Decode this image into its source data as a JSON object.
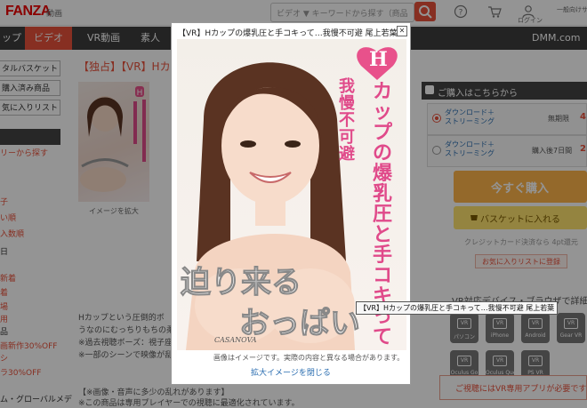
{
  "header": {
    "logo": "FANZA",
    "logo_sub": "動画",
    "search_placeholder": "ビデオ ▼  キーワードから探す（商品",
    "icons": [
      "question-icon",
      "cart-icon",
      "user-icon"
    ],
    "icon_labels": [
      "ログイン",
      "一般向けサ"
    ]
  },
  "nav": {
    "items": [
      "ップ",
      "ビデオ",
      "VR動画",
      "素人",
      "DMM.com"
    ],
    "active_index": 1
  },
  "sidebar": {
    "buttons": [
      "タルバスケット",
      "購入済み商品",
      "気に入りリスト"
    ],
    "section_label": "リーから探す",
    "red_items": [
      "子",
      "い順",
      "入数順"
    ],
    "black_items": [
      "日"
    ],
    "more_red": [
      "新着",
      "着",
      "場",
      "用"
    ],
    "more_black": [
      "品"
    ],
    "sale_items": [
      "画新作30%OFF",
      "シ",
      "ラ30%OFF"
    ],
    "bottom_items": [
      "ム・グローバルメデ"
    ]
  },
  "main": {
    "title": "【独占】【VR】Hカ",
    "thumb_caption": "イメージを拡大",
    "body_lines": [
      "Hカップという圧倒的ボ",
      "うなのにむっちりもちの柔ら",
      "※過去視聴ボーズ：視子座",
      "※一部のシーンで映像が乱れ",
      "【※画像・音声に多少の乱れがあります】",
      "※この商品は専用プレイヤーでの視聴に最適化されています。"
    ]
  },
  "right": {
    "header": "ご購入はこちらから",
    "options": [
      {
        "label1": "ダウンロード＋",
        "label2": "ストリーミング",
        "price_label": "無期限",
        "price": "4",
        "selected": true
      },
      {
        "label1": "ダウンロード＋",
        "label2": "ストリーミング",
        "price_label": "購入後7日間",
        "price": "2",
        "selected": false
      }
    ],
    "buy": "今すぐ購入",
    "basket": "バスケットに入れる",
    "credit": "クレジットカード決済なら 4pt還元",
    "favorite": "お気に入りリストに登録",
    "vr_header": "VR対応デバイス・ブラウザで詳細表示",
    "devices": [
      "パソコン",
      "iPhone",
      "Android",
      "Gear VR",
      "Oculus Go",
      "Oculus Quest",
      "PS VR"
    ],
    "vr_notice": "ご視聴にはVR専用アプリが必要です"
  },
  "modal": {
    "title": "【VR】Hカップの爆乳圧と手コキって…我慢不可避 尾上若葉",
    "close": "✕",
    "note": "画像はイメージです。実際の内容と異なる場合があります。",
    "close_link": "拡大イメージを閉じる",
    "tooltip": "【VR】Hカップの爆乳圧と手コキって…我慢不可避 尾上若葉",
    "image_text": {
      "h_badge": "H",
      "line1": "カップの爆乳圧と手コキって",
      "line2": "我慢不可避",
      "bottom1": "迫り来る",
      "bottom2": "おっぱい",
      "brand": "CASANOVA"
    }
  },
  "colors": {
    "accent": "#e8513b",
    "nav_bg": "#3d3d3d",
    "buy": "#ffb54a",
    "basket": "#ffe36e",
    "link": "#2a6db0"
  }
}
